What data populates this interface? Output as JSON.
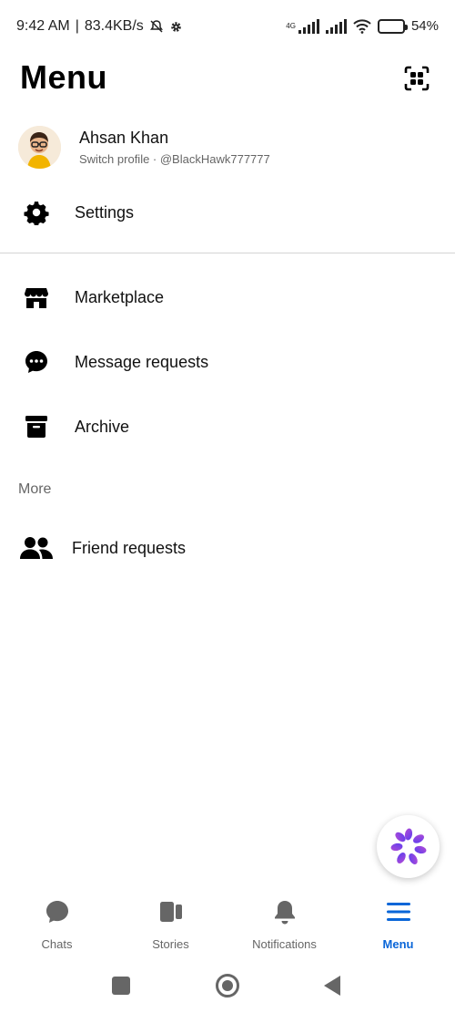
{
  "status_bar": {
    "time": "9:42 AM",
    "speed": "83.4KB/s",
    "network": "4G",
    "battery": "54%",
    "battery_level": 0.54
  },
  "header": {
    "title": "Menu",
    "qr_icon": "qr-scan-icon"
  },
  "profile": {
    "name": "Ahsan Khan",
    "subtitle": "Switch profile · @BlackHawk777777"
  },
  "menu": {
    "settings": {
      "label": "Settings",
      "icon": "gear-icon"
    },
    "items": [
      {
        "label": "Marketplace",
        "icon": "storefront-icon"
      },
      {
        "label": "Message requests",
        "icon": "chat-bubble-icon"
      },
      {
        "label": "Archive",
        "icon": "archive-box-icon"
      }
    ],
    "section_more": "More",
    "more_items": [
      {
        "label": "Friend requests",
        "icon": "people-icon"
      }
    ]
  },
  "fab": {
    "icon": "meta-ai-icon"
  },
  "bottom_nav": [
    {
      "label": "Chats",
      "icon": "chat-icon",
      "active": false
    },
    {
      "label": "Stories",
      "icon": "stories-icon",
      "active": false
    },
    {
      "label": "Notifications",
      "icon": "bell-icon",
      "active": false
    },
    {
      "label": "Menu",
      "icon": "hamburger-icon",
      "active": true
    }
  ],
  "colors": {
    "accent": "#0a66d8",
    "inactive": "#666666",
    "text": "#111111",
    "divider": "#d4d4d4"
  }
}
